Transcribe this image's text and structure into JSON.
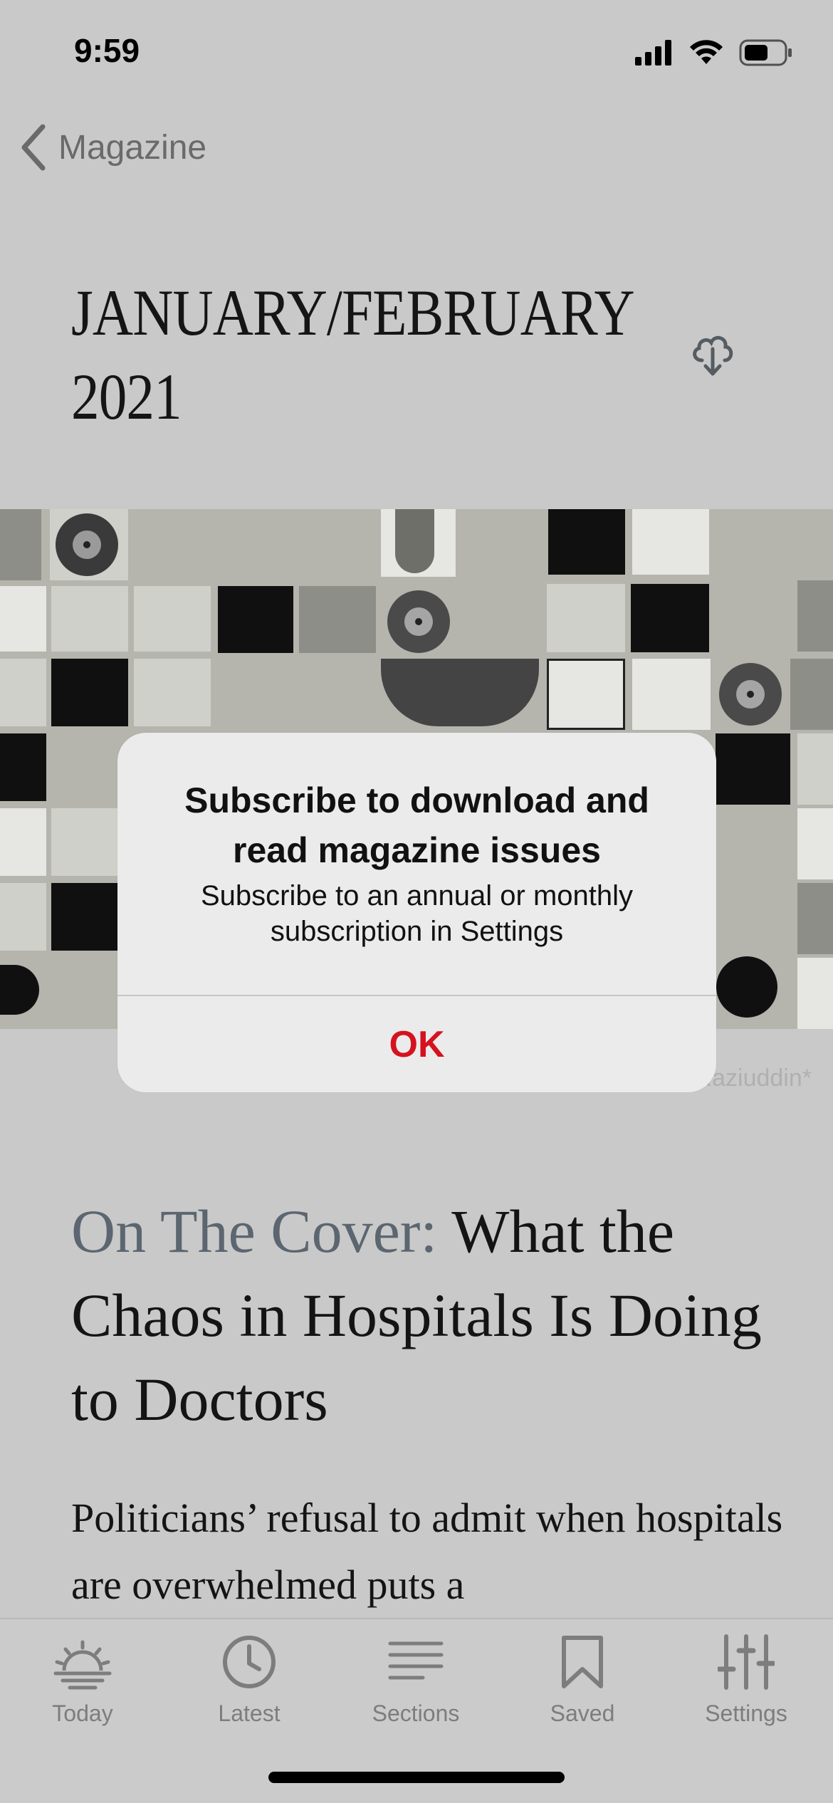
{
  "status_bar": {
    "time": "9:59"
  },
  "nav": {
    "back_label": "Magazine"
  },
  "issue": {
    "title_line1": "JANUARY/FEBRUARY",
    "title_line2": "2021"
  },
  "cover": {
    "credit": "Photo illustration by Arsh Raziuddin*"
  },
  "article": {
    "kicker": "On The Cover:",
    "title": "What the Chaos in Hospitals Is Doing to Doctors",
    "dek": "Politicians’ refusal to admit when hospitals are overwhelmed puts a"
  },
  "alert": {
    "title": "Subscribe to download and read magazine issues",
    "message": "Subscribe to an annual or monthly subscription in Settings",
    "ok_label": "OK"
  },
  "tab_bar": {
    "items": [
      {
        "label": "Today",
        "icon": "sunrise-icon"
      },
      {
        "label": "Latest",
        "icon": "clock-icon"
      },
      {
        "label": "Sections",
        "icon": "list-icon"
      },
      {
        "label": "Saved",
        "icon": "bookmark-icon"
      },
      {
        "label": "Settings",
        "icon": "sliders-icon"
      }
    ]
  },
  "colors": {
    "accent_red": "#d5121f",
    "dim_overlay_bg": "#c9c9c9",
    "kicker_gray": "#5c6670"
  }
}
